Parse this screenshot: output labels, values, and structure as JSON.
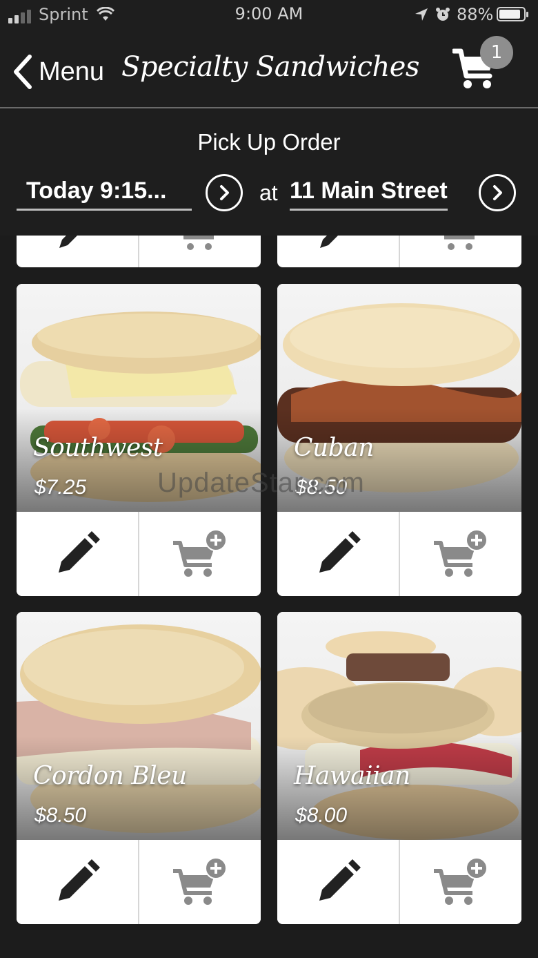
{
  "status_bar": {
    "carrier": "Sprint",
    "time": "9:00 AM",
    "battery_percent": "88%",
    "battery_level": 0.88,
    "icons": [
      "signal-icon",
      "wifi-icon",
      "location-arrow-icon",
      "alarm-icon",
      "battery-icon"
    ]
  },
  "nav": {
    "back_label": "Menu",
    "title": "Specialty Sandwiches",
    "cart_count": "1"
  },
  "pickup": {
    "heading": "Pick Up Order",
    "time_value": "Today 9:15...",
    "at_label": "at",
    "location_value": "11 Main Street"
  },
  "products": [
    {
      "name": "Southwest",
      "price": "$7.25"
    },
    {
      "name": "Cuban",
      "price": "$8.50"
    },
    {
      "name": "Cordon Bleu",
      "price": "$8.50"
    },
    {
      "name": "Hawaiian",
      "price": "$8.00"
    }
  ],
  "watermark": "UpdateStar.com",
  "colors": {
    "background": "#1c1c1c",
    "header": "#1e1e1e",
    "card": "#ffffff",
    "badge": "#8e8e8e",
    "icon_dark": "#222222",
    "icon_gray": "#8a8a8a"
  }
}
